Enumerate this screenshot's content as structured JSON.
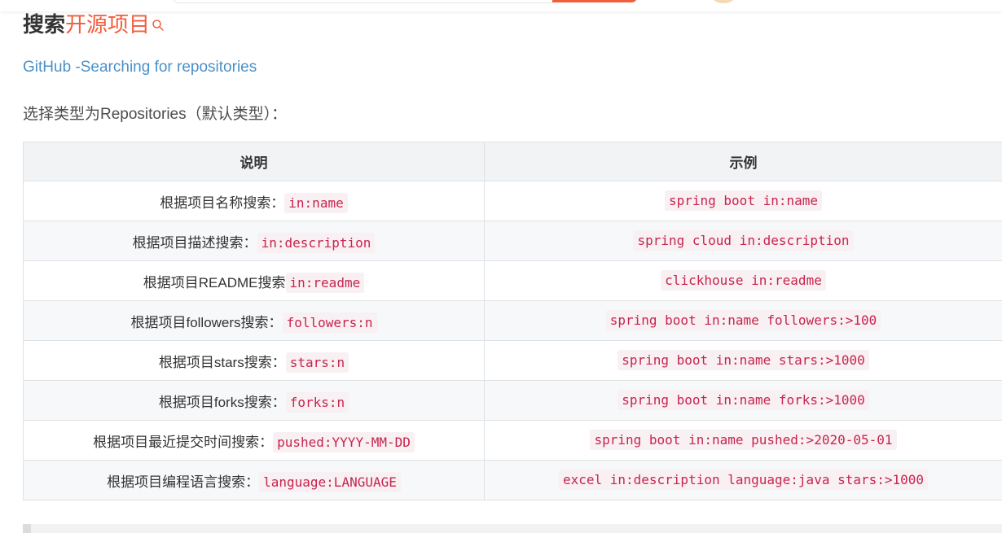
{
  "heading": {
    "part1": "搜索",
    "part2": "开源项目"
  },
  "link": {
    "text": "GitHub -Searching for repositories"
  },
  "intro": {
    "text": "选择类型为Repositories（默认类型）："
  },
  "table": {
    "headers": [
      "说明",
      "示例"
    ],
    "rows": [
      {
        "desc": "根据项目名称搜索：",
        "code": "in:name",
        "example": "spring boot in:name"
      },
      {
        "desc": "根据项目描述搜索：",
        "code": "in:description",
        "example": "spring cloud in:description"
      },
      {
        "desc": "根据项目README搜索",
        "code": "in:readme",
        "example": "clickhouse in:readme"
      },
      {
        "desc": "根据项目followers搜索：",
        "code": "followers:n",
        "example": "spring boot in:name followers:>100"
      },
      {
        "desc": "根据项目stars搜索：",
        "code": "stars:n",
        "example": "spring boot in:name stars:>1000"
      },
      {
        "desc": "根据项目forks搜索：",
        "code": "forks:n",
        "example": "spring boot in:name forks:>1000"
      },
      {
        "desc": "根据项目最近提交时间搜索：",
        "code": "pushed:YYYY-MM-DD",
        "example": "spring boot in:name pushed:>2020-05-01"
      },
      {
        "desc": "根据项目编程语言搜索：",
        "code": "language:LANGUAGE",
        "example": "excel in:description language:java stars:>1000"
      }
    ]
  },
  "colors": {
    "accent": "#f25d3c",
    "link": "#4a90c8",
    "code_text": "#c7254e",
    "code_bg": "#f8f0f2",
    "header_bg": "#f1f3f5",
    "alt_row_bg": "#f6f8fa"
  },
  "icons": {
    "title_icon": "search-icon"
  }
}
